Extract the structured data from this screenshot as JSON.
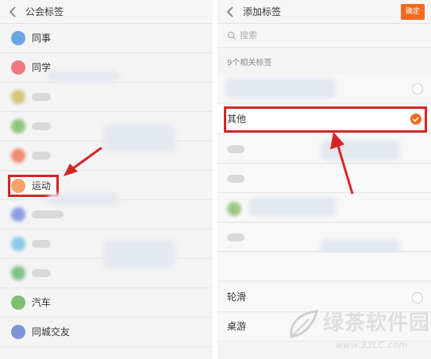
{
  "left": {
    "title": "公会标签",
    "items": [
      {
        "label": "同事",
        "icon": "colleague-icon",
        "color": "#6ea4e4"
      },
      {
        "label": "同学",
        "icon": "classmate-icon",
        "color": "#ef7b80"
      },
      {
        "label": "",
        "icon": "blurred-icon",
        "color": "#d6c47a"
      },
      {
        "label": "",
        "icon": "blurred-icon",
        "color": "#8bc77c"
      },
      {
        "label": "",
        "icon": "blurred-icon",
        "color": "#ee8a70"
      },
      {
        "label": "运动",
        "icon": "sports-icon",
        "color": "#f4a46a"
      },
      {
        "label": "",
        "icon": "blurred-icon",
        "color": "#8d9fe0"
      },
      {
        "label": "",
        "icon": "blurred-icon",
        "color": "#8cc8ea"
      },
      {
        "label": "",
        "icon": "blurred-icon",
        "color": "#7dc487"
      },
      {
        "label": "汽车",
        "icon": "car-icon",
        "color": "#7fbf6f"
      },
      {
        "label": "同城交友",
        "icon": "local-friends-icon",
        "color": "#7a95d8"
      }
    ]
  },
  "right": {
    "title": "添加标签",
    "confirm_label": "确定",
    "search_placeholder": "搜索",
    "section_title": "9个相关标签",
    "items": [
      {
        "label": "",
        "selected": false
      },
      {
        "label": "其他",
        "selected": true
      },
      {
        "label": "",
        "selected": false
      },
      {
        "label": "",
        "selected": false
      },
      {
        "label": "",
        "selected": false
      },
      {
        "label": "",
        "selected": false
      },
      {
        "label": "轮滑",
        "selected": false
      },
      {
        "label": "桌游",
        "selected": false
      }
    ]
  },
  "watermark": {
    "text": "绿茶软件园",
    "url": "www.33LC.com"
  },
  "colors": {
    "accent": "#f26a20",
    "highlight": "#d62424"
  }
}
